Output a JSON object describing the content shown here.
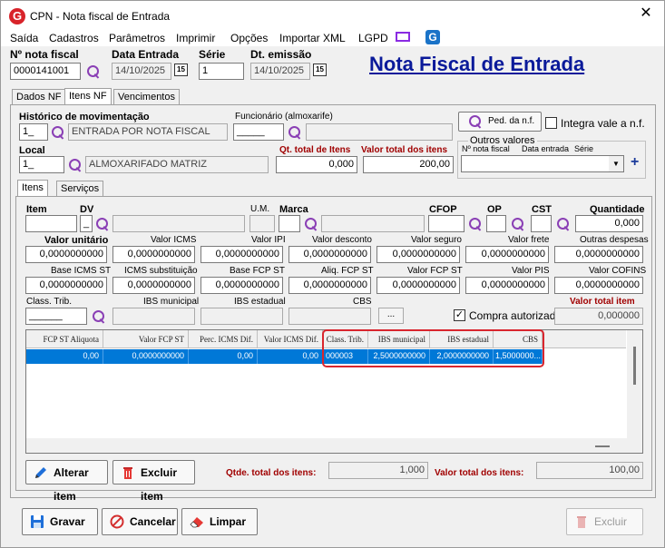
{
  "window": {
    "title": "CPN - Nota fiscal de Entrada",
    "close_glyph": "✕"
  },
  "menu": [
    "Saída",
    "Cadastros",
    "Parâmetros",
    "Imprimir",
    "Opções",
    "Importar XML",
    "LGPD"
  ],
  "header": {
    "nf_label": "Nº nota fiscal",
    "nf_value": "0000141001",
    "data_entrada_label": "Data Entrada",
    "data_entrada_value": "14/10/2025",
    "serie_label": "Série",
    "serie_value": "1",
    "dt_emissao_label": "Dt. emissão",
    "dt_emissao_value": "14/10/2025",
    "calendar_glyph": "15",
    "page_title": "Nota Fiscal de Entrada"
  },
  "tabs": [
    "Dados NF",
    "Itens NF",
    "Vencimentos"
  ],
  "mov": {
    "historico_label": "Histórico de movimentação",
    "historico_code": "1_",
    "historico_desc": "ENTRADA POR NOTA FISCAL",
    "funcionario_label": "Funcionário (almoxarife)",
    "funcionario_value": "_____",
    "ped_button": "Ped. da n.f.",
    "integra_label": "Integra vale a n.f.",
    "local_label": "Local",
    "local_code": "1_",
    "local_desc": "ALMOXARIFADO MATRIZ",
    "qt_total_label": "Qt. total de Itens",
    "qt_total_value": "0,000",
    "valor_total_label": "Valor total dos itens",
    "valor_total_value": "200,00",
    "outros_label": "Outros valores",
    "outros_cols": [
      "Nº nota fiscal",
      "Data entrada",
      "Série"
    ],
    "plus_glyph": "+",
    "dropdown_glyph": "▼"
  },
  "subtabs": [
    "Itens",
    "Serviços"
  ],
  "item": {
    "item_label": "Item",
    "dv_label": "DV",
    "dv_value": "_",
    "um_label": "U.M.",
    "marca_label": "Marca",
    "cfop_label": "CFOP",
    "op_label": "OP",
    "cst_label": "CST",
    "quantidade_label": "Quantidade",
    "quantidade_value": "0,000",
    "row2": [
      {
        "label": "Valor unitário",
        "value": "0,0000000000",
        "bold": true
      },
      {
        "label": "Valor ICMS",
        "value": "0,0000000000"
      },
      {
        "label": "Valor IPI",
        "value": "0,0000000000"
      },
      {
        "label": "Valor desconto",
        "value": "0,0000000000"
      },
      {
        "label": "Valor seguro",
        "value": "0,0000000000"
      },
      {
        "label": "Valor frete",
        "value": "0,0000000000"
      },
      {
        "label": "Outras despesas",
        "value": "0,0000000000"
      }
    ],
    "row3": [
      {
        "label": "Base ICMS ST",
        "value": "0,0000000000"
      },
      {
        "label": "ICMS substituição",
        "value": "0,0000000000"
      },
      {
        "label": "Base FCP ST",
        "value": "0,0000000000"
      },
      {
        "label": "Aliq. FCP ST",
        "value": "0,0000000000"
      },
      {
        "label": "Valor FCP ST",
        "value": "0,0000000000"
      },
      {
        "label": "Valor PIS",
        "value": "0,0000000000"
      },
      {
        "label": "Valor COFINS",
        "value": "0,0000000000"
      }
    ],
    "class_trib_label": "Class. Trib.",
    "class_trib_value": "______",
    "ibs_mun_label": "IBS municipal",
    "ibs_est_label": "IBS estadual",
    "cbs_label": "CBS",
    "ellipsis": "...",
    "compra_label": "Compra autorizada",
    "compra_checked": "✓",
    "valor_total_item_label": "Valor total item",
    "valor_total_item_value": "0,000000"
  },
  "grid": {
    "headers": [
      "FCP ST Aliquota",
      "Valor FCP ST",
      "Perc. ICMS Dif.",
      "Valor ICMS Dif.",
      "Class. Trib.",
      "IBS municipal",
      "IBS estadual",
      "CBS"
    ],
    "row": [
      "0,00",
      "0,0000000000",
      "0,00",
      "0,00",
      "000003",
      "2,5000000000",
      "2,0000000000",
      "1,5000000..."
    ]
  },
  "bottom": {
    "alterar": "Alterar item",
    "excluir": "Excluir item",
    "qtde_label": "Qtde. total dos itens:",
    "qtde_value": "1,000",
    "valor_label": "Valor total dos itens:",
    "valor_value": "100,00"
  },
  "footer": {
    "gravar": "Gravar",
    "cancelar": "Cancelar",
    "limpar": "Limpar",
    "excluir": "Excluir"
  },
  "colors": {
    "accent": "#0078d7",
    "title_blue": "#0a1a9a",
    "highlight": "#d9262e",
    "label_red": "#a00000",
    "icon_purple": "#8a3fb5"
  }
}
